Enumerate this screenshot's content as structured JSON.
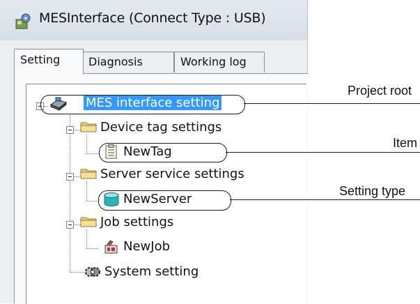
{
  "window": {
    "title": "MESInterface (Connect Type : USB)",
    "app_icon": "mes-interface-icon"
  },
  "tabs": [
    {
      "label": "Setting",
      "active": true
    },
    {
      "label": "Diagnosis",
      "active": false
    },
    {
      "label": "Working log",
      "active": false
    }
  ],
  "tree": {
    "root": {
      "label": "MES interface setting",
      "icon": "project-icon",
      "selected": true
    },
    "device_tag": {
      "label": "Device tag settings",
      "icon": "folder-icon",
      "child": {
        "label": "NewTag",
        "icon": "tag-icon"
      }
    },
    "server_service": {
      "label": "Server service settings",
      "icon": "folder-icon",
      "child": {
        "label": "NewServer",
        "icon": "server-icon"
      }
    },
    "job": {
      "label": "Job settings",
      "icon": "folder-icon",
      "child": {
        "label": "NewJob",
        "icon": "job-icon"
      }
    },
    "system": {
      "label": "System setting",
      "icon": "system-icon"
    }
  },
  "annotations": {
    "project_root": "Project root",
    "item": "Item",
    "setting_type": "Setting type"
  },
  "colors": {
    "selection": "#3399ff",
    "titlebar": "#dbe2ec",
    "folder": "#e8cf7a",
    "server": "#2bb3b8"
  }
}
